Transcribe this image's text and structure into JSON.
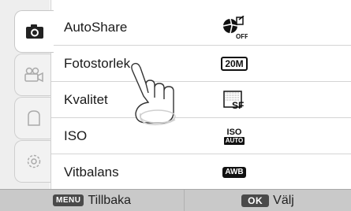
{
  "tabs": [
    {
      "icon": "camera-icon",
      "active": true
    },
    {
      "icon": "video-camera-icon",
      "active": false
    },
    {
      "icon": "user-icon",
      "active": false
    },
    {
      "icon": "gear-icon",
      "active": false
    }
  ],
  "menu": {
    "items": [
      {
        "label": "AutoShare",
        "value_icon": "autoshare-off-icon",
        "value_text": "OFF"
      },
      {
        "label": "Fotostorlek",
        "value_icon": "photo-size-icon",
        "value_text": "20M"
      },
      {
        "label": "Kvalitet",
        "value_icon": "quality-superfine-icon",
        "value_text": "SF"
      },
      {
        "label": "ISO",
        "value_icon": "iso-auto-icon",
        "value_text_top": "ISO",
        "value_text_bottom": "AUTO"
      },
      {
        "label": "Vitbalans",
        "value_icon": "white-balance-auto-icon",
        "value_text": "AWB"
      }
    ]
  },
  "bottom_bar": {
    "back_key": "MENU",
    "back_label": "Tillbaka",
    "select_key": "OK",
    "select_label": "Välj"
  }
}
